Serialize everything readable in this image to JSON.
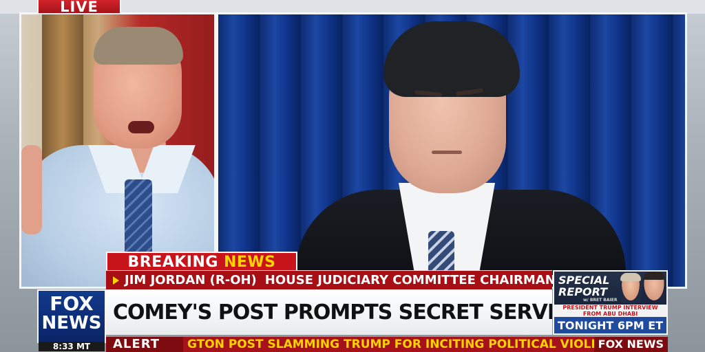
{
  "live_bug": {
    "label": "LIVE"
  },
  "lower_third": {
    "label_word1": "BREAKING",
    "label_word2": "NEWS",
    "guest_name": "JIM JORDAN (R-OH)",
    "guest_title": "HOUSE JUDICIARY COMMITTEE CHAIRMAN",
    "headline": "COMEY'S POST PROMPTS SECRET SERVICE INVESTIGATION"
  },
  "network": {
    "logo_line1": "FOX",
    "logo_line2": "NEWS",
    "clock": "8:33 MT"
  },
  "promo": {
    "show_title": "SPECIAL REPORT",
    "host_credit": "w/ BRET BAIER",
    "tease": "PRESIDENT TRUMP INTERVIEW FROM ABU DHABI",
    "airtime": "TONIGHT 6PM ET"
  },
  "ticker": {
    "label": "ALERT",
    "text": "GTON POST SLAMMING TRUMP FOR INCITING POLITICAL VIOLENCE",
    "brand": "FOX NEWS"
  },
  "colors": {
    "brand_red": "#c7151b",
    "brand_blue": "#123a8c",
    "accent_yellow": "#ffd200"
  }
}
